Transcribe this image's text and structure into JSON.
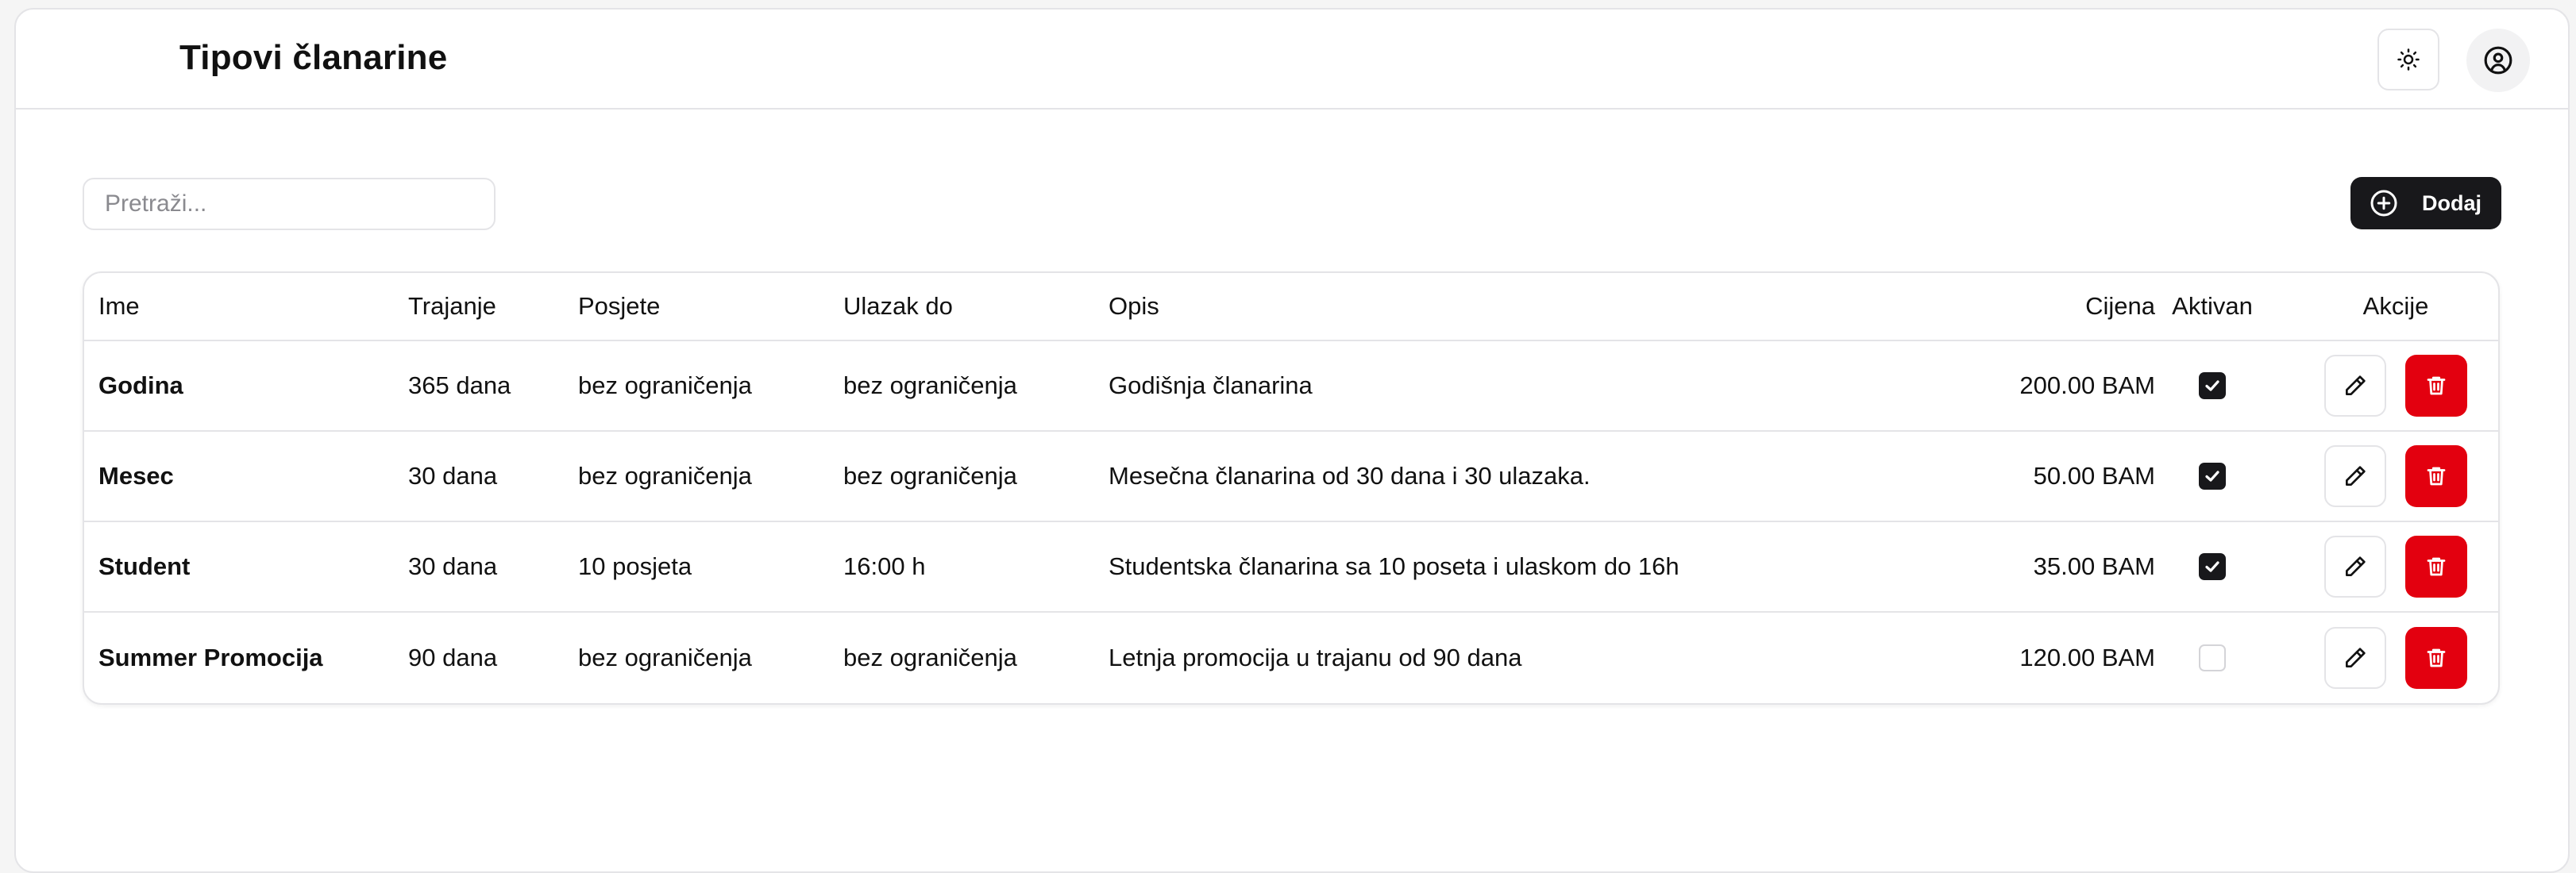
{
  "header": {
    "title": "Tipovi članarine",
    "theme_toggle_icon": "sun-icon",
    "user_icon": "user-circle-icon"
  },
  "toolbar": {
    "search_placeholder": "Pretraži...",
    "search_value": "",
    "add_label": "Dodaj",
    "add_icon": "plus-circle-icon"
  },
  "table": {
    "columns": {
      "name": "Ime",
      "duration": "Trajanje",
      "visits": "Posjete",
      "entry_until": "Ulazak do",
      "description": "Opis",
      "price": "Cijena",
      "active": "Aktivan",
      "actions": "Akcije"
    },
    "rows": [
      {
        "name": "Godina",
        "duration": "365 dana",
        "visits": "bez ograničenja",
        "entry_until": "bez ograničenja",
        "description": "Godišnja članarina",
        "price": "200.00 BAM",
        "active": true
      },
      {
        "name": "Mesec",
        "duration": "30 dana",
        "visits": "bez ograničenja",
        "entry_until": "bez ograničenja",
        "description": "Mesečna članarina od 30 dana i 30 ulazaka.",
        "price": "50.00 BAM",
        "active": true
      },
      {
        "name": "Student",
        "duration": "30 dana",
        "visits": "10 posjeta",
        "entry_until": "16:00 h",
        "description": "Studentska članarina sa 10 poseta i ulaskom do 16h",
        "price": "35.00 BAM",
        "active": true
      },
      {
        "name": "Summer Promocija",
        "duration": "90 dana",
        "visits": "bez ograničenja",
        "entry_until": "bez ograničenja",
        "description": "Letnja promocija u trajanu od 90 dana",
        "price": "120.00 BAM",
        "active": false
      }
    ],
    "edit_icon": "pencil-icon",
    "delete_icon": "trash-icon"
  },
  "colors": {
    "primary_button": "#18181b",
    "danger_button": "#e3000f",
    "border": "#e4e4e7"
  }
}
